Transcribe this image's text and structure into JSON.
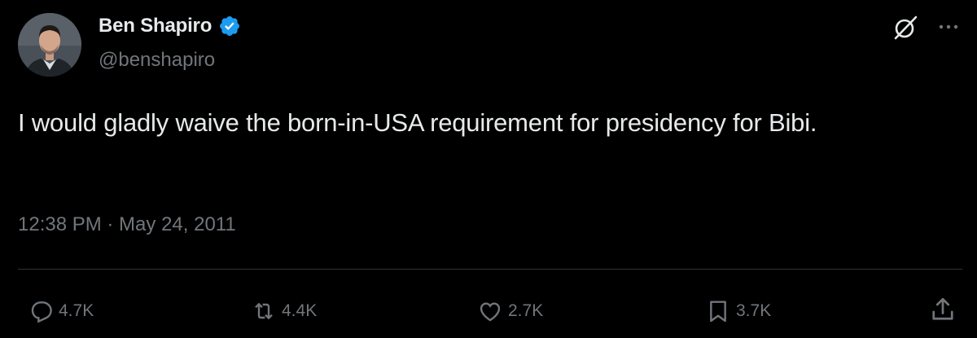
{
  "author": {
    "name": "Ben Shapiro",
    "handle": "@benshapiro",
    "verified": true,
    "verified_color": "#1d9bf0"
  },
  "tweet": {
    "text": "I would gladly waive the born-in-USA requirement for presidency for Bibi.",
    "timestamp": "12:38 PM · May 24, 2011"
  },
  "actions": {
    "reply_count": "4.7K",
    "repost_count": "4.4K",
    "like_count": "2.7K",
    "bookmark_count": "3.7K"
  },
  "icons": {
    "grok": "grok-icon",
    "more": "more-icon",
    "reply": "reply-icon",
    "repost": "repost-icon",
    "like": "heart-icon",
    "bookmark": "bookmark-icon",
    "share": "share-icon"
  },
  "colors": {
    "background": "#000000",
    "text_primary": "#e7e9ea",
    "text_secondary": "#71767b",
    "divider": "#2f3336"
  }
}
